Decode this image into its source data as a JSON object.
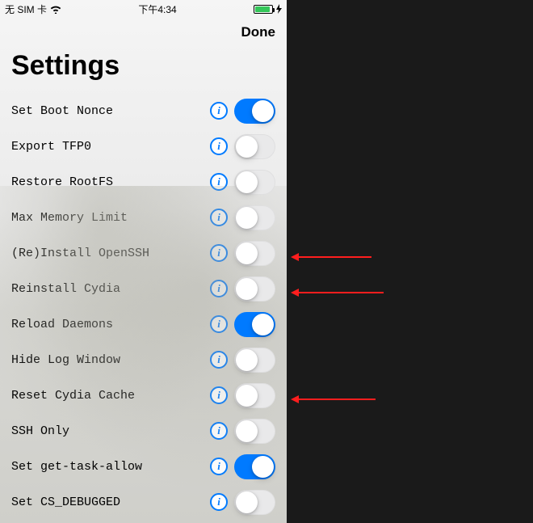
{
  "status": {
    "left_text": "无 SIM 卡",
    "time": "下午4:34"
  },
  "nav": {
    "done_label": "Done"
  },
  "title": "Settings",
  "colors": {
    "accent": "#007aff",
    "arrow": "#ff1e1e",
    "battery_fill": "#34c759"
  },
  "settings": [
    {
      "label": "Set Boot Nonce",
      "on": true
    },
    {
      "label": "Export TFP0",
      "on": false
    },
    {
      "label": "Restore RootFS",
      "on": false
    },
    {
      "label": "Max Memory Limit",
      "on": false
    },
    {
      "label": "(Re)Install OpenSSH",
      "on": false
    },
    {
      "label": "Reinstall Cydia",
      "on": false
    },
    {
      "label": "Reload Daemons",
      "on": true
    },
    {
      "label": "Hide Log Window",
      "on": false
    },
    {
      "label": "Reset Cydia Cache",
      "on": false
    },
    {
      "label": "SSH Only",
      "on": false
    },
    {
      "label": "Set get-task-allow",
      "on": true
    },
    {
      "label": "Set CS_DEBUGGED",
      "on": false
    }
  ],
  "annotations": {
    "arrows_point_to_rows": [
      4,
      5,
      8
    ]
  }
}
